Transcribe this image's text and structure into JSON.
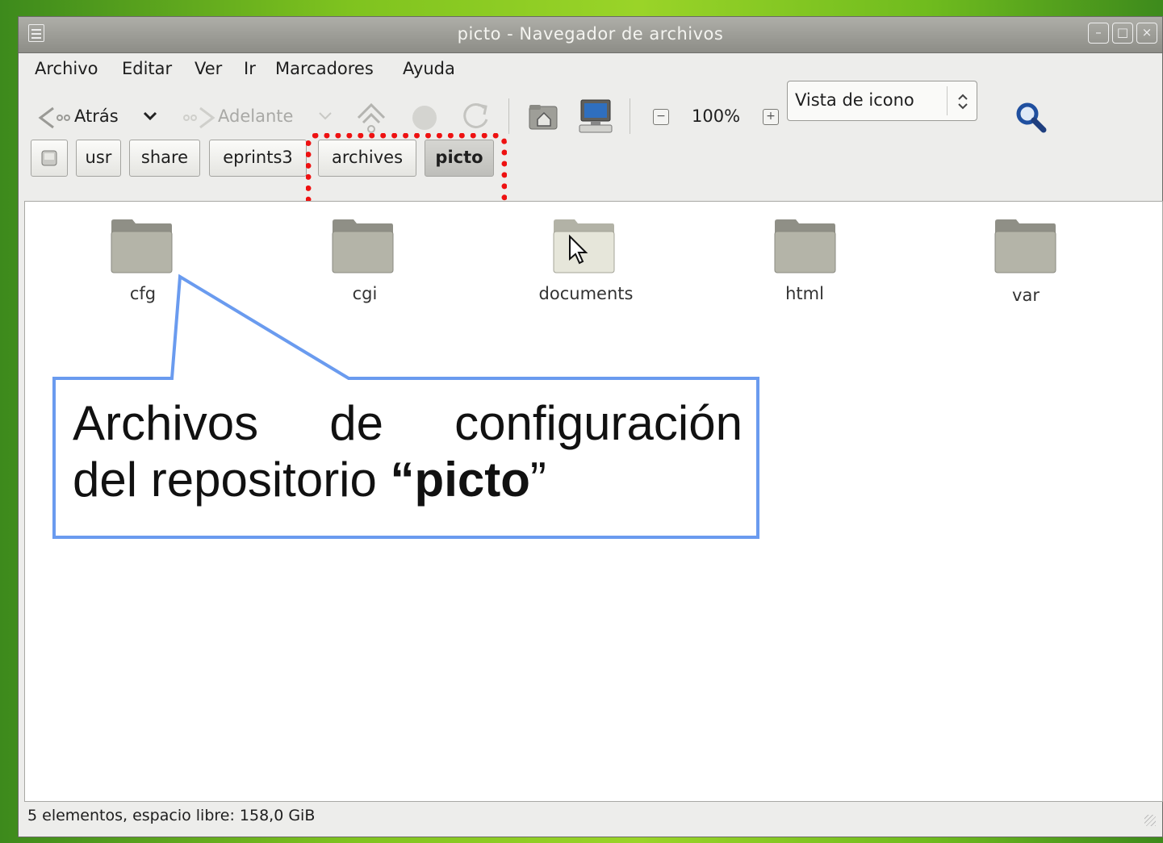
{
  "window": {
    "title": "picto - Navegador de archivos",
    "controls": [
      "–",
      "□",
      "×"
    ]
  },
  "menubar": {
    "items": [
      "Archivo",
      "Editar",
      "Ver",
      "Ir",
      "Marcadores",
      "Ayuda"
    ]
  },
  "toolbar": {
    "back_label": "Atrás",
    "forward_label": "Adelante",
    "zoom_level": "100%",
    "view_mode": "Vista de icono",
    "icons": [
      "back-arrow-icon",
      "chevron-down-icon",
      "forward-arrow-icon",
      "up-arrow-icon",
      "stop-icon",
      "reload-icon",
      "home-folder-icon",
      "computer-icon",
      "zoom-out-icon",
      "zoom-in-icon",
      "search-icon"
    ]
  },
  "pathbar": {
    "crumbs": [
      "usr",
      "share",
      "eprints3",
      "archives",
      "picto"
    ],
    "active": "picto"
  },
  "files": [
    {
      "name": "cfg"
    },
    {
      "name": "cgi"
    },
    {
      "name": "documents"
    },
    {
      "name": "html"
    },
    {
      "name": "var"
    }
  ],
  "status": {
    "text": "5 elementos, espacio libre: 158,0 GiB"
  },
  "callout": {
    "line1_words": [
      "Archivos",
      "de",
      "configuración"
    ],
    "line2_prefix": "del repositorio ",
    "line2_open_quote": "“",
    "line2_bold": "picto",
    "line2_close_quote": "”",
    "color_border": "#6a9bef",
    "color_highlight": "#ee1111"
  }
}
